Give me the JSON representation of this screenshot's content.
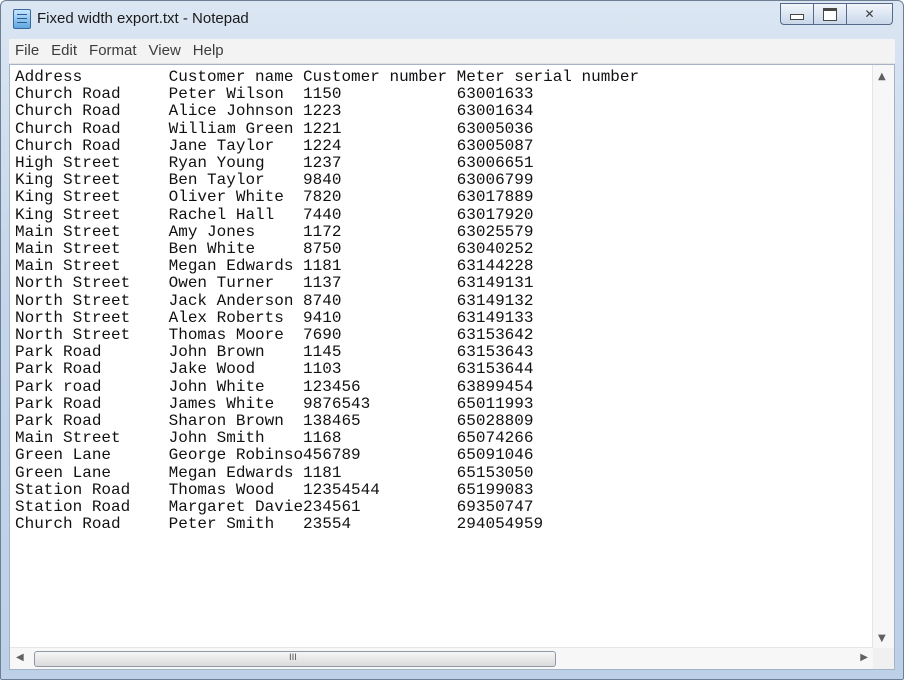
{
  "window": {
    "title": "Fixed width export.txt - Notepad"
  },
  "menu": [
    "File",
    "Edit",
    "Format",
    "View",
    "Help"
  ],
  "document": {
    "lines": [
      "Address         Customer name Customer number Meter serial number",
      "Church Road     Peter Wilson  1150            63001633",
      "Church Road     Alice Johnson 1223            63001634",
      "Church Road     William Green 1221            63005036",
      "Church Road     Jane Taylor   1224            63005087",
      "High Street     Ryan Young    1237            63006651",
      "King Street     Ben Taylor    9840            63006799",
      "King Street     Oliver White  7820            63017889",
      "King Street     Rachel Hall   7440            63017920",
      "Main Street     Amy Jones     1172            63025579",
      "Main Street     Ben White     8750            63040252",
      "Main Street     Megan Edwards 1181            63144228",
      "North Street    Owen Turner   1137            63149131",
      "North Street    Jack Anderson 8740            63149132",
      "North Street    Alex Roberts  9410            63149133",
      "North Street    Thomas Moore  7690            63153642",
      "Park Road       John Brown    1145            63153643",
      "Park Road       Jake Wood     1103            63153644",
      "Park road       John White    123456          63899454",
      "Park Road       James White   9876543         65011993",
      "Park Road       Sharon Brown  138465          65028809",
      "Main Street     John Smith    1168            65074266",
      "Green Lane      George Robinso456789          65091046",
      "Green Lane      Megan Edwards 1181            65153050",
      "Station Road    Thomas Wood   12354544        65199083",
      "Station Road    Margaret Davie234561          69350747",
      "Church Road     Peter Smith   23554           294054959"
    ]
  },
  "icons": {
    "app": "notepad-icon",
    "minimize": "minimize-icon",
    "maximize": "maximize-icon",
    "close": "close-icon",
    "scroll_up": "scroll-up-icon",
    "scroll_down": "scroll-down-icon",
    "scroll_left": "scroll-left-icon",
    "scroll_right": "scroll-right-icon"
  },
  "glyphs": {
    "close": "✕",
    "up": "▲",
    "down": "▼",
    "left": "◀",
    "right": "▶",
    "grip": "III"
  }
}
